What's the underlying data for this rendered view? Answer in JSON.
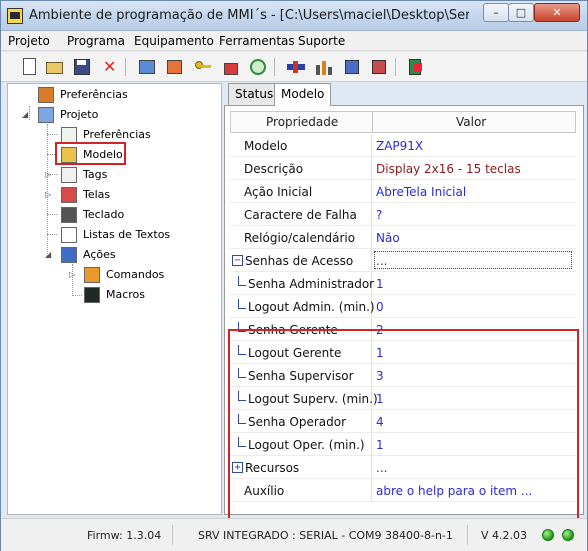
{
  "window": {
    "title": "Ambiente de programação de MMI´s - [C:\\Users\\maciel\\Desktop\\Senha de Acesso...",
    "controls": {
      "minimize": "–",
      "maximize": "□",
      "close": "✕"
    }
  },
  "menu": [
    "Projeto",
    "Programa",
    "Equipamento",
    "Ferramentas",
    "Suporte"
  ],
  "toolbar_icons": [
    "new-file-icon",
    "open-folder-icon",
    "save-icon",
    "delete-icon",
    "transfer-icon",
    "send-icon",
    "key-icon",
    "compile-icon",
    "refresh-icon",
    "connect-icon",
    "signal-icon",
    "chip-icon",
    "program-icon",
    "exit-icon"
  ],
  "tree": {
    "root_preferences": "Preferências",
    "project": "Projeto",
    "preferences": "Preferências",
    "model": "Modelo",
    "tags": "Tags",
    "screens": "Telas",
    "keyboard": "Teclado",
    "text_lists": "Listas de Textos",
    "actions": "Ações",
    "commands": "Comandos",
    "macros": "Macros"
  },
  "tabs": {
    "status": "Status",
    "model": "Modelo"
  },
  "grid": {
    "header_property": "Propriedade",
    "header_value": "Valor",
    "rows": [
      {
        "name": "Modelo",
        "value": "ZAP91X",
        "value_color": "#2b2bd6"
      },
      {
        "name": "Descrição",
        "value": "Display 2x16 - 15 teclas",
        "value_color": "#8b1a1a"
      },
      {
        "name": "Ação Inicial",
        "value": "AbreTela Inicial",
        "value_color": "#2b2bd6"
      },
      {
        "name": "Caractere de Falha",
        "value": "?",
        "value_color": "#2b2bd6"
      },
      {
        "name": "Relógio/calendário",
        "value": "Não",
        "value_color": "#2b2bd6"
      },
      {
        "name": "Senhas de Acesso",
        "value": "...",
        "value_color": "#2b2bd6",
        "expandable": "−"
      },
      {
        "name": "Senha Administrador",
        "value": "1",
        "value_color": "#2b2bd6"
      },
      {
        "name": "Logout Admin. (min.)",
        "value": "0",
        "value_color": "#2b2bd6"
      },
      {
        "name": "Senha Gerente",
        "value": "2",
        "value_color": "#2b2bd6"
      },
      {
        "name": "Logout Gerente",
        "value": "1",
        "value_color": "#2b2bd6"
      },
      {
        "name": "Senha Supervisor",
        "value": "3",
        "value_color": "#2b2bd6"
      },
      {
        "name": "Logout Superv. (min.)",
        "value": "1",
        "value_color": "#2b2bd6"
      },
      {
        "name": "Senha Operador",
        "value": "4",
        "value_color": "#2b2bd6"
      },
      {
        "name": "Logout Oper. (min.)",
        "value": "1",
        "value_color": "#2b2bd6"
      },
      {
        "name": "Recursos",
        "value": "...",
        "value_color": "#2b2bd6",
        "expandable": "+"
      },
      {
        "name": "Auxílio",
        "value": "abre o help para o item ...",
        "value_color": "#2b2bd6"
      }
    ]
  },
  "status": {
    "firmware": "Firmw: 1.3.04",
    "connection": "SRV INTEGRADO : SERIAL - COM9 38400-8-n-1",
    "version": "V 4.2.03"
  },
  "colors": {
    "highlight": "#d2232a",
    "link": "#2b2bd6",
    "description": "#8b1a1a",
    "led": "#1f9a1a"
  }
}
